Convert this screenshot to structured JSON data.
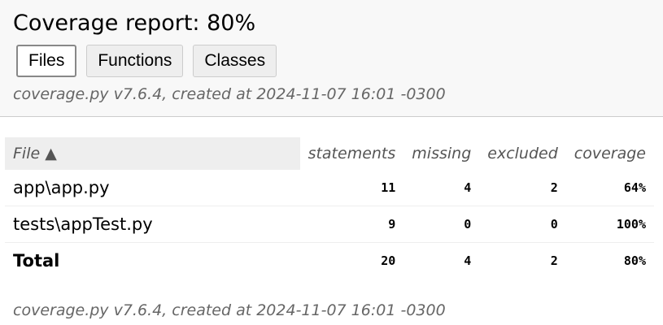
{
  "header": {
    "title": "Coverage report: 80%",
    "tabs": [
      {
        "label": "Files",
        "active": true
      },
      {
        "label": "Functions",
        "active": false
      },
      {
        "label": "Classes",
        "active": false
      }
    ],
    "created": "coverage.py v7.6.4, created at 2024-11-07 16:01 -0300"
  },
  "table": {
    "columns": {
      "file": "File ▲",
      "statements": "statements",
      "missing": "missing",
      "excluded": "excluded",
      "coverage": "coverage"
    },
    "rows": [
      {
        "file": "app\\app.py",
        "statements": "11",
        "missing": "4",
        "excluded": "2",
        "coverage": "64%"
      },
      {
        "file": "tests\\appTest.py",
        "statements": "9",
        "missing": "0",
        "excluded": "0",
        "coverage": "100%"
      }
    ],
    "total": {
      "file": "Total",
      "statements": "20",
      "missing": "4",
      "excluded": "2",
      "coverage": "80%"
    }
  },
  "footer": {
    "created": "coverage.py v7.6.4, created at 2024-11-07 16:01 -0300"
  },
  "colors": {
    "header_bg": "#f8f8f8",
    "tab_bg": "#eeeeee",
    "muted_text": "#666666"
  }
}
